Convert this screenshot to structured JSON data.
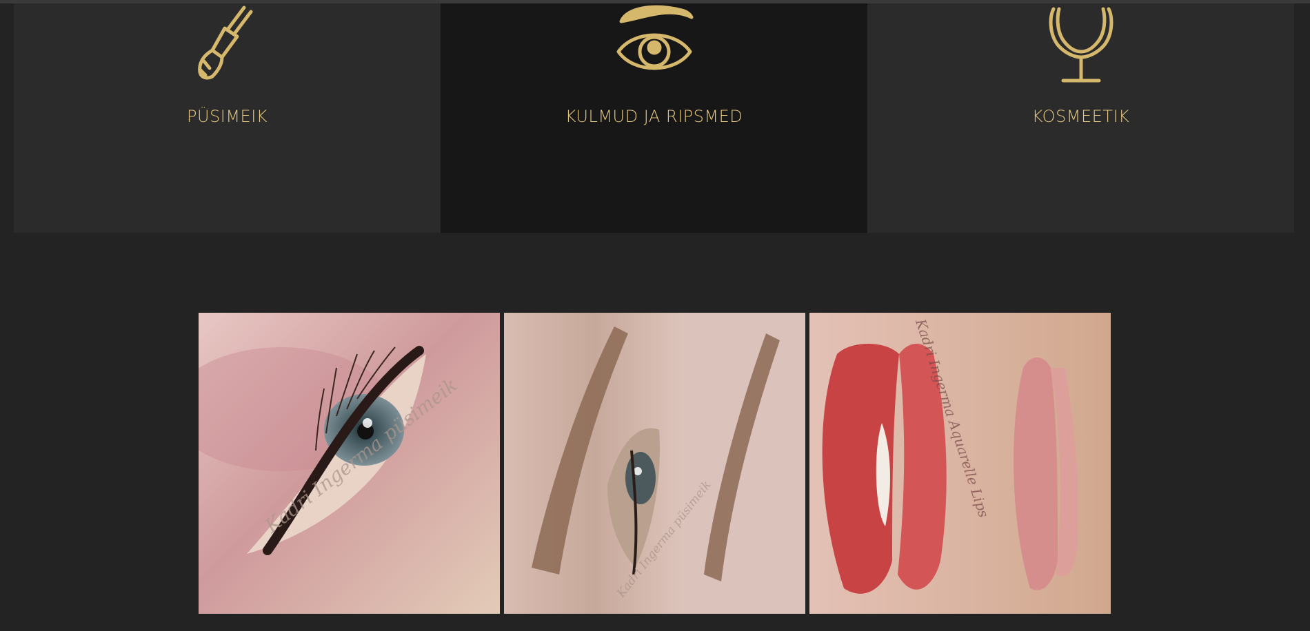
{
  "services": [
    {
      "label": "PÜSIMEIK",
      "icon": "makeup-brush-icon"
    },
    {
      "label": "KULMUD JA RIPSMED",
      "icon": "eye-with-brow-icon"
    },
    {
      "label": "KOSMEETIK",
      "icon": "mirror-icon"
    }
  ],
  "gallery": [
    {
      "watermark": "Kadri Ingerma püsimeik",
      "subject": "eyeliner"
    },
    {
      "watermark": "Kadri Ingerma püsimeik",
      "subject": "eyebrows"
    },
    {
      "watermark": "Kadri Ingerma Aquarelle Lips",
      "subject": "lips"
    }
  ],
  "colors": {
    "accent": "#e5c77f",
    "page_background": "#232323",
    "card_light": "#2b2b2b",
    "card_dark": "#171717"
  }
}
